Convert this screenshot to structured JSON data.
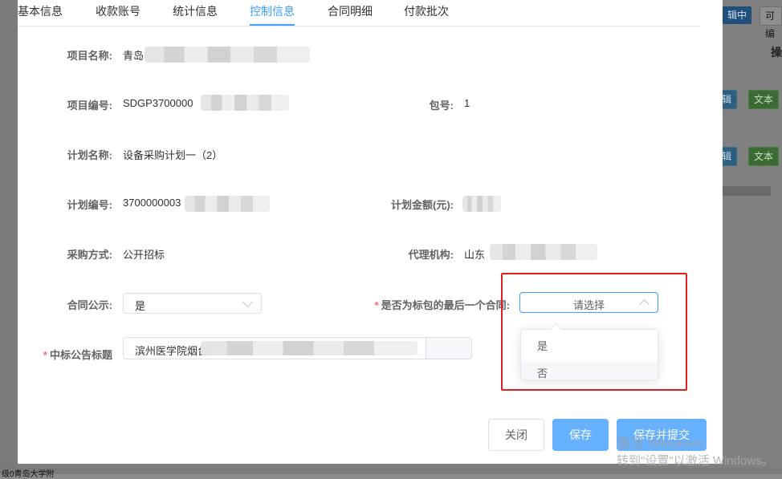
{
  "tabs": [
    "基本信息",
    "收款账号",
    "统计信息",
    "控制信息",
    "合同明细",
    "付款批次"
  ],
  "active_tab": "控制信息",
  "fields": {
    "project_name": {
      "label": "项目名称:",
      "value": "青岛"
    },
    "project_no": {
      "label": "项目编号:",
      "value": "SDGP3700000"
    },
    "package_no": {
      "label": "包号:",
      "value": "1"
    },
    "plan_name": {
      "label": "计划名称:",
      "value": "设备采购计划一（2）"
    },
    "plan_no": {
      "label": "计划编号:",
      "value": "3700000003"
    },
    "plan_amount": {
      "label": "计划金额(元):",
      "value": ""
    },
    "purchase_method": {
      "label": "采购方式:",
      "value": "公开招标"
    },
    "agency": {
      "label": "代理机构:",
      "value": "山东"
    },
    "contract_publicity": {
      "label": "合同公示:",
      "value": "是"
    },
    "last_contract": {
      "required": "*",
      "label": "是否为标包的最后一个合同:",
      "placeholder": "请选择"
    },
    "bid_notice_title": {
      "required": "*",
      "label": "中标公告标题",
      "value": "滨州医学院烟台"
    }
  },
  "dropdown_options": [
    "是",
    "否"
  ],
  "buttons": {
    "close": "关闭",
    "save": "保存",
    "save_submit": "保存并提交"
  },
  "background": {
    "top_tag_1": "辑中",
    "top_tag_2": "可编",
    "operations_header": "操",
    "row_edit": "辑",
    "row_text": "文本",
    "bottom_text": "级0青岛大学附"
  },
  "watermark": {
    "line1": "激活 Windows",
    "line2": "转到\"设置\"以激活 Windows。"
  },
  "colors": {
    "primary": "#409eff",
    "required": "#f56c6c",
    "highlight_box": "#e02020"
  }
}
